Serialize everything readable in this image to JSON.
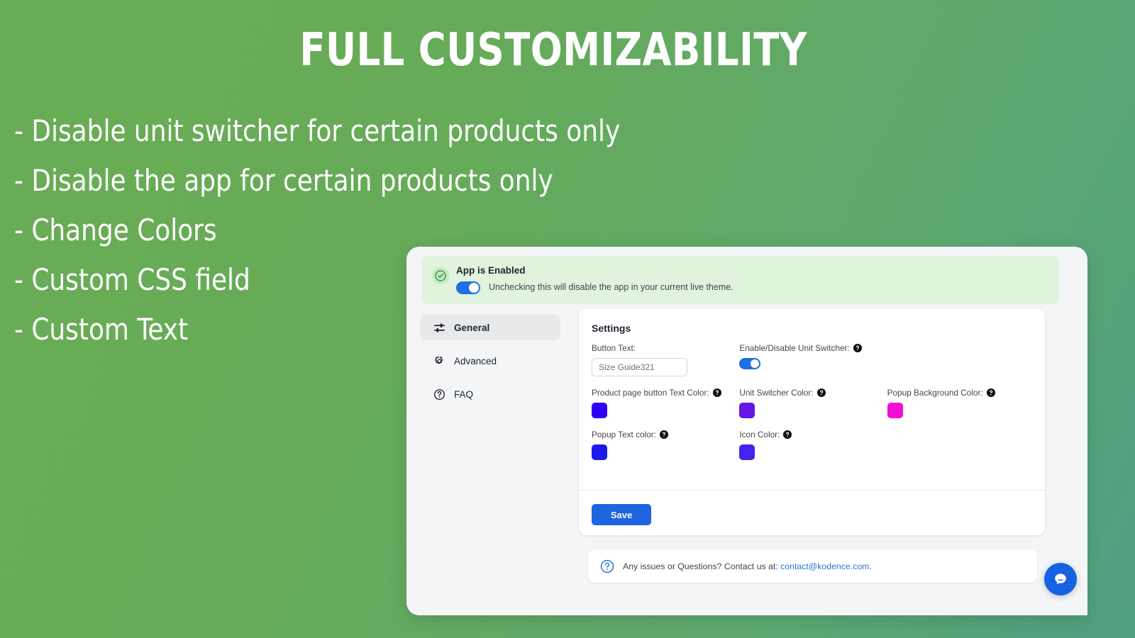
{
  "hero": {
    "title": "FULL CUSTOMIZABILITY",
    "bullets": [
      "- Disable unit switcher for certain products only",
      "- Disable the app for certain products only",
      "- Change Colors",
      "- Custom CSS field",
      "- Custom Text"
    ]
  },
  "app": {
    "banner": {
      "title": "App is Enabled",
      "description": "Unchecking this will disable the app in your current live theme.",
      "toggle_on": true,
      "background": "#dff3dd",
      "check_icon": "circle-check-icon"
    },
    "sidebar": {
      "items": [
        {
          "label": "General",
          "icon": "sliders-icon",
          "active": true
        },
        {
          "label": "Advanced",
          "icon": "gear-icon",
          "active": false
        },
        {
          "label": "FAQ",
          "icon": "question-circle-icon",
          "active": false
        }
      ]
    },
    "settings": {
      "title": "Settings",
      "fields": [
        {
          "label": "Button Text:",
          "type": "text",
          "value": "Size Guide321",
          "placeholder": "Size Guide321",
          "has_help": false
        },
        {
          "label": "Enable/Disable Unit Switcher:",
          "type": "toggle",
          "value": true,
          "has_help": true
        },
        {
          "label": "Product page button Text Color:",
          "type": "color",
          "value": "#2e00f5",
          "has_help": true
        },
        {
          "label": "Unit Switcher Color:",
          "type": "color",
          "value": "#6615e8",
          "has_help": true
        },
        {
          "label": "Popup Background Color:",
          "type": "color",
          "value": "#f40ed8",
          "has_help": true
        },
        {
          "label": "Popup Text color:",
          "type": "color",
          "value": "#1c18f0",
          "has_help": true
        },
        {
          "label": "Icon Color:",
          "type": "color",
          "value": "#4423ee",
          "has_help": true
        }
      ],
      "save_label": "Save"
    },
    "contact": {
      "icon": "question-circle-icon",
      "text_before": "Any issues or Questions? Contact us at: ",
      "email": "contact@kodence.com",
      "text_after": "."
    },
    "chat": {
      "icon": "chat-bubble-icon",
      "color": "#1762e3"
    }
  }
}
